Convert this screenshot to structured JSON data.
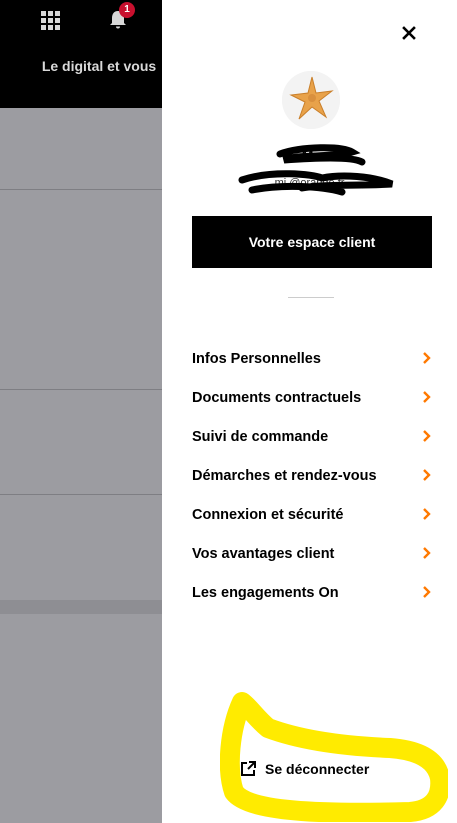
{
  "background_page": {
    "notification_count": "1",
    "title": "Le digital et vous"
  },
  "panel": {
    "user": {
      "name": "Mi",
      "email": "mi       @orange.fr"
    },
    "espace_client_label": "Votre espace client",
    "menu_items": [
      {
        "label": "Infos Personnelles",
        "icon": "chevron-right-icon"
      },
      {
        "label": "Documents contractuels",
        "icon": "chevron-right-icon"
      },
      {
        "label": "Suivi de commande",
        "icon": "chevron-right-icon"
      },
      {
        "label": "Démarches et rendez-vous",
        "icon": "chevron-right-icon"
      },
      {
        "label": "Connexion et sécurité",
        "icon": "chevron-right-icon"
      },
      {
        "label": "Vos avantages client",
        "icon": "chevron-right-icon"
      },
      {
        "label": "Les engagements On",
        "icon": "chevron-right-icon"
      }
    ],
    "logout_label": "Se déconnecter"
  },
  "colors": {
    "accent": "#ff7900",
    "highlight": "#ffeb00",
    "badge": "#c8102e",
    "button": "#000000"
  }
}
